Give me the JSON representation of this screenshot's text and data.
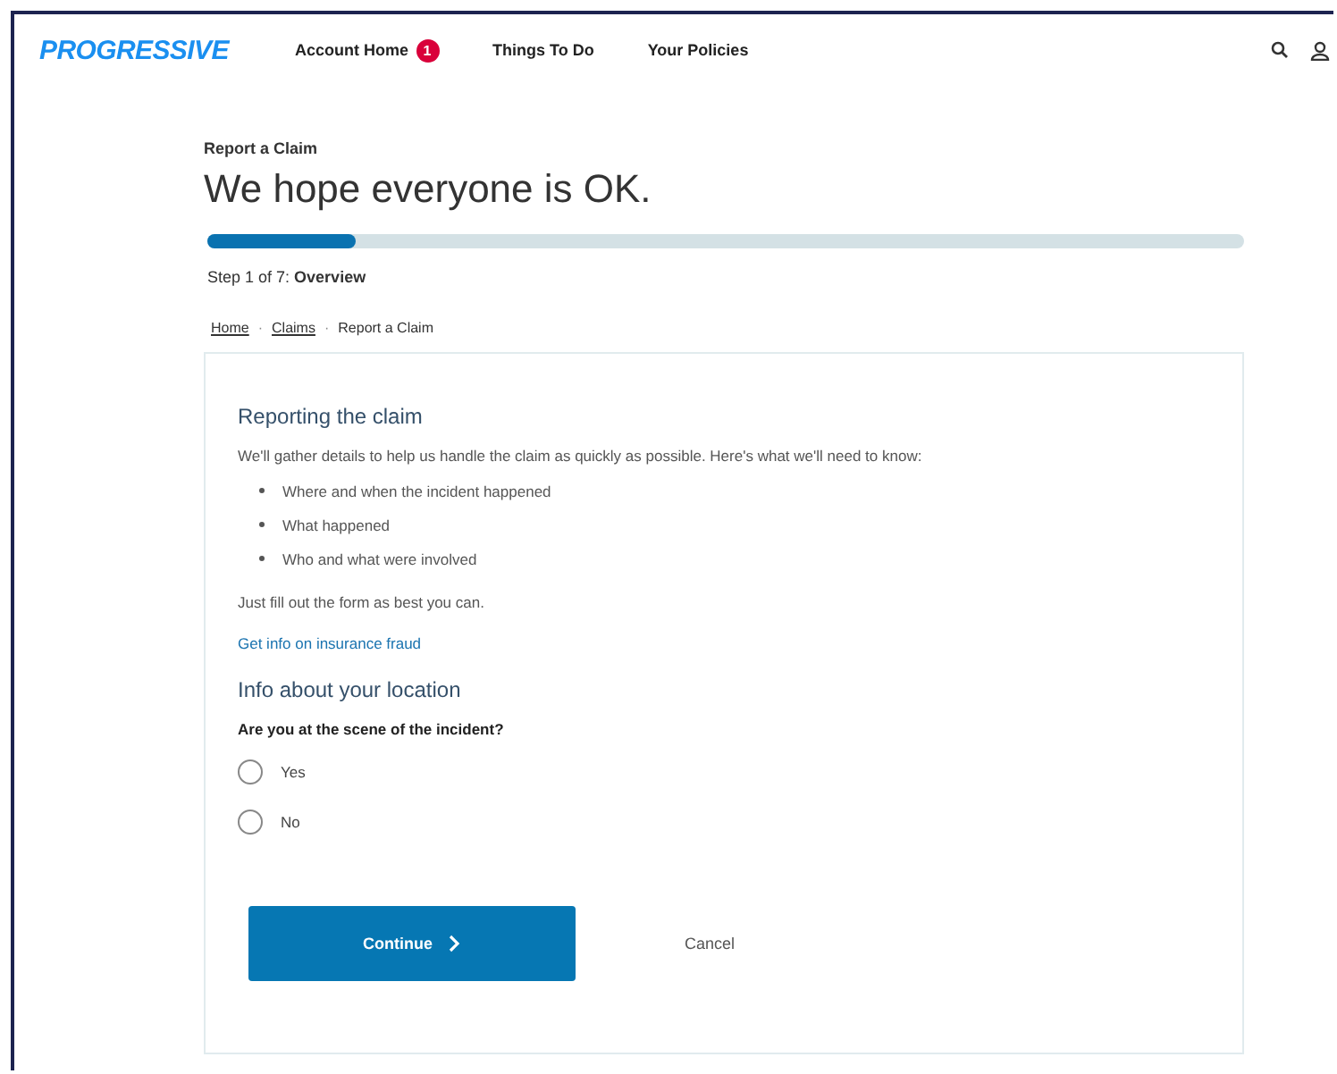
{
  "header": {
    "logo": "PROGRESSIVE",
    "nav": [
      {
        "label": "Account Home",
        "badge": "1"
      },
      {
        "label": "Things To Do"
      },
      {
        "label": "Your Policies"
      }
    ]
  },
  "page": {
    "eyebrow": "Report a Claim",
    "title": "We hope everyone is OK.",
    "progress": {
      "level": 0.143
    },
    "step": "Step 1 of 7: **Overview**"
  },
  "breadcrumb": {
    "separator": "·",
    "items": [
      {
        "label": "Home",
        "link": true
      },
      {
        "label": "Claims",
        "link": true
      },
      {
        "label": "Report a Claim",
        "link": false
      }
    ]
  },
  "card": {
    "heading": "Reporting the claim",
    "intro": "We'll gather details to help us handle the claim as quickly as possible. Here's what we'll need to know:",
    "bullets": [
      "Where and when the incident happened",
      "What happened",
      "Who and what were involved"
    ],
    "note": "Just fill out the form as best you can.",
    "link": "Get info on insurance fraud",
    "section": "Info about your location",
    "question": "Are you at the scene of the incident?",
    "options": [
      {
        "label": "Yes",
        "selected": false
      },
      {
        "label": "No",
        "selected": false
      }
    ],
    "primary": "Continue",
    "secondary": "Cancel"
  }
}
